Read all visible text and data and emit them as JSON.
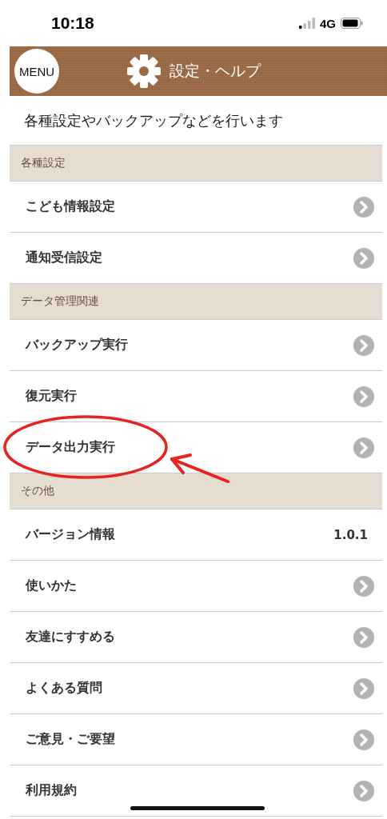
{
  "status_bar": {
    "time": "10:18",
    "network": "4G"
  },
  "header": {
    "menu_label": "MENU",
    "title": "設定・ヘルプ"
  },
  "description": "各種設定やバックアップなどを行います",
  "sections": [
    {
      "title": "各種設定",
      "rows": [
        {
          "kind": "link",
          "label": "こども情報設定",
          "highlighted": false
        },
        {
          "kind": "link",
          "label": "通知受信設定",
          "highlighted": false
        }
      ]
    },
    {
      "title": "データ管理関連",
      "rows": [
        {
          "kind": "link",
          "label": "バックアップ実行",
          "highlighted": false
        },
        {
          "kind": "link",
          "label": "復元実行",
          "highlighted": false
        },
        {
          "kind": "link",
          "label": "データ出力実行",
          "highlighted": true
        }
      ]
    },
    {
      "title": "その他",
      "rows": [
        {
          "kind": "value",
          "label": "バージョン情報",
          "value": "1.0.1",
          "highlighted": false
        },
        {
          "kind": "link",
          "label": "使いかた",
          "highlighted": false
        },
        {
          "kind": "link",
          "label": "友達にすすめる",
          "highlighted": false
        },
        {
          "kind": "link",
          "label": "よくある質問",
          "highlighted": false
        },
        {
          "kind": "link",
          "label": "ご意見・ご要望",
          "highlighted": false
        },
        {
          "kind": "link",
          "label": "利用規約",
          "highlighted": false
        }
      ]
    }
  ]
}
